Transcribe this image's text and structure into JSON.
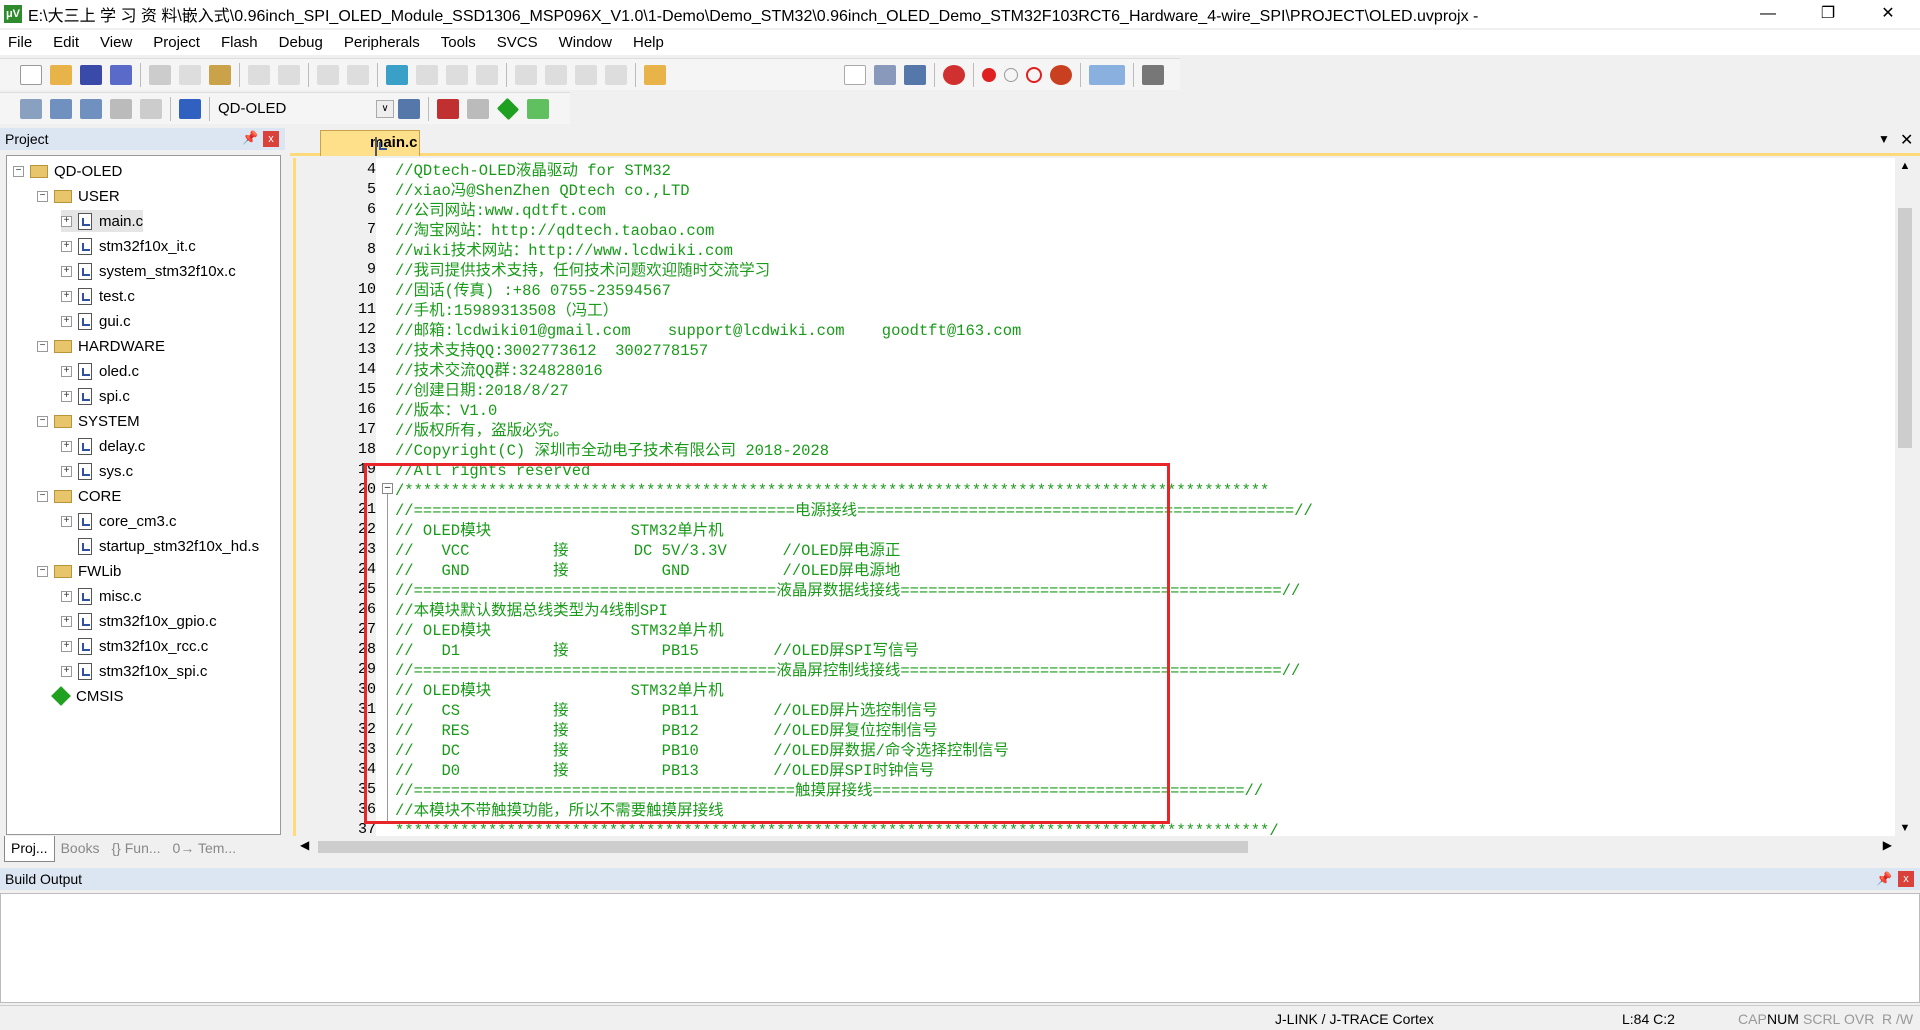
{
  "window": {
    "title": "E:\\大三上 学 习 资 料\\嵌入式\\0.96inch_SPI_OLED_Module_SSD1306_MSP096X_V1.0\\1-Demo\\Demo_STM32\\0.96inch_OLED_Demo_STM32F103RCT6_Hardware_4-wire_SPI\\PROJECT\\OLED.uvprojx -",
    "logo": "μV"
  },
  "menu": [
    "File",
    "Edit",
    "View",
    "Project",
    "Flash",
    "Debug",
    "Peripherals",
    "Tools",
    "SVCS",
    "Window",
    "Help"
  ],
  "toolbar": {
    "target": "QD-OLED"
  },
  "project_panel": {
    "title": "Project",
    "tree": [
      {
        "label": "QD-OLED",
        "level": 0,
        "type": "root"
      },
      {
        "label": "USER",
        "level": 1,
        "type": "folder"
      },
      {
        "label": "main.c",
        "level": 2,
        "type": "file",
        "selected": true
      },
      {
        "label": "stm32f10x_it.c",
        "level": 2,
        "type": "file"
      },
      {
        "label": "system_stm32f10x.c",
        "level": 2,
        "type": "file"
      },
      {
        "label": "test.c",
        "level": 2,
        "type": "file"
      },
      {
        "label": "gui.c",
        "level": 2,
        "type": "file"
      },
      {
        "label": "HARDWARE",
        "level": 1,
        "type": "folder"
      },
      {
        "label": "oled.c",
        "level": 2,
        "type": "file"
      },
      {
        "label": "spi.c",
        "level": 2,
        "type": "file"
      },
      {
        "label": "SYSTEM",
        "level": 1,
        "type": "folder"
      },
      {
        "label": "delay.c",
        "level": 2,
        "type": "file"
      },
      {
        "label": "sys.c",
        "level": 2,
        "type": "file"
      },
      {
        "label": "CORE",
        "level": 1,
        "type": "folder"
      },
      {
        "label": "core_cm3.c",
        "level": 2,
        "type": "file"
      },
      {
        "label": "startup_stm32f10x_hd.s",
        "level": 2,
        "type": "file",
        "noexp": true
      },
      {
        "label": "FWLib",
        "level": 1,
        "type": "folder"
      },
      {
        "label": "misc.c",
        "level": 2,
        "type": "file"
      },
      {
        "label": "stm32f10x_gpio.c",
        "level": 2,
        "type": "file"
      },
      {
        "label": "stm32f10x_rcc.c",
        "level": 2,
        "type": "file"
      },
      {
        "label": "stm32f10x_spi.c",
        "level": 2,
        "type": "file"
      },
      {
        "label": "CMSIS",
        "level": 1,
        "type": "component"
      }
    ],
    "tabs": [
      "Proj...",
      "Books",
      "{} Fun...",
      "0→ Tem..."
    ]
  },
  "editor": {
    "tab": "main.c",
    "lines": [
      {
        "n": "4",
        "t": "//QDtech-OLED液晶驱动 for STM32"
      },
      {
        "n": "5",
        "t": "//xiao冯@ShenZhen QDtech co.,LTD"
      },
      {
        "n": "6",
        "t": "//公司网站:www.qdtft.com"
      },
      {
        "n": "7",
        "t": "//淘宝网站：http://qdtech.taobao.com"
      },
      {
        "n": "8",
        "t": "//wiki技术网站：http://www.lcdwiki.com"
      },
      {
        "n": "9",
        "t": "//我司提供技术支持，任何技术问题欢迎随时交流学习"
      },
      {
        "n": "10",
        "t": "//固话(传真) :+86 0755-23594567"
      },
      {
        "n": "11",
        "t": "//手机:15989313508（冯工）"
      },
      {
        "n": "12",
        "t": "//邮箱:lcdwiki01@gmail.com    support@lcdwiki.com    goodtft@163.com"
      },
      {
        "n": "13",
        "t": "//技术支持QQ:3002773612  3002778157"
      },
      {
        "n": "14",
        "t": "//技术交流QQ群:324828016"
      },
      {
        "n": "15",
        "t": "//创建日期:2018/8/27"
      },
      {
        "n": "16",
        "t": "//版本：V1.0"
      },
      {
        "n": "17",
        "t": "//版权所有，盗版必究。"
      },
      {
        "n": "18",
        "t": "//Copyright(C) 深圳市全动电子技术有限公司 2018-2028"
      },
      {
        "n": "19",
        "t": "//All rights reserved"
      },
      {
        "n": "20",
        "t": "/*********************************************************************************************"
      },
      {
        "n": "21",
        "t": "//=========================================电源接线===============================================//"
      },
      {
        "n": "22",
        "t": "// OLED模块               STM32单片机"
      },
      {
        "n": "23",
        "t": "//   VCC         接       DC 5V/3.3V      //OLED屏电源正"
      },
      {
        "n": "24",
        "t": "//   GND         接          GND          //OLED屏电源地"
      },
      {
        "n": "25",
        "t": "//=======================================液晶屏数据线接线=========================================//"
      },
      {
        "n": "26",
        "t": "//本模块默认数据总线类型为4线制SPI"
      },
      {
        "n": "27",
        "t": "// OLED模块               STM32单片机"
      },
      {
        "n": "28",
        "t": "//   D1          接          PB15        //OLED屏SPI写信号"
      },
      {
        "n": "29",
        "t": "//=======================================液晶屏控制线接线=========================================//"
      },
      {
        "n": "30",
        "t": "// OLED模块               STM32单片机"
      },
      {
        "n": "31",
        "t": "//   CS          接          PB11        //OLED屏片选控制信号"
      },
      {
        "n": "32",
        "t": "//   RES         接          PB12        //OLED屏复位控制信号"
      },
      {
        "n": "33",
        "t": "//   DC          接          PB10        //OLED屏数据/命令选择控制信号"
      },
      {
        "n": "34",
        "t": "//   D0          接          PB13        //OLED屏SPI时钟信号"
      },
      {
        "n": "35",
        "t": "//=========================================触摸屏接线========================================//"
      },
      {
        "n": "36",
        "t": "//本模块不带触摸功能，所以不需要触摸屏接线"
      },
      {
        "n": "37",
        "t": "**********************************************************************************************/"
      }
    ]
  },
  "build_output": {
    "title": "Build Output"
  },
  "status": {
    "debugger": "J-LINK / J-TRACE Cortex",
    "position": "L:84 C:2",
    "indicators": [
      "CAP",
      "NUM",
      "SCRL",
      "OVR",
      "R /W"
    ]
  },
  "colors": {
    "comment": "#1a9a1a",
    "highlight_box": "#e8262a",
    "tab": "#ffe08a"
  }
}
